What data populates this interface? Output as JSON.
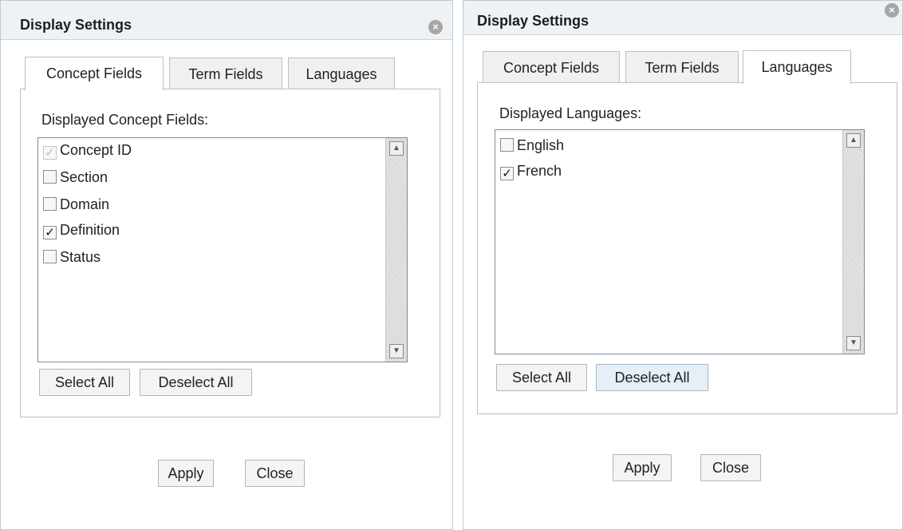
{
  "left": {
    "title": "Display Settings",
    "close_glyph": "×",
    "tabs": [
      "Concept Fields",
      "Term Fields",
      "Languages"
    ],
    "active_tab": "Concept Fields",
    "panel_label": "Displayed Concept Fields:",
    "items": [
      {
        "label": "Concept ID",
        "mark": "✓",
        "checked": true,
        "disabled": true
      },
      {
        "label": "Section",
        "mark": "",
        "checked": false
      },
      {
        "label": "Domain",
        "mark": "",
        "checked": false
      },
      {
        "label": "Definition",
        "mark": "✓",
        "checked": true
      },
      {
        "label": "Status",
        "mark": "",
        "checked": false
      }
    ],
    "select_all": "Select All",
    "deselect_all": "Deselect All",
    "apply": "Apply",
    "close": "Close"
  },
  "right": {
    "title": "Display Settings",
    "close_glyph": "×",
    "tabs": [
      "Concept Fields",
      "Term Fields",
      "Languages"
    ],
    "active_tab": "Languages",
    "panel_label": "Displayed Languages:",
    "items": [
      {
        "label": "English",
        "mark": "",
        "checked": false
      },
      {
        "label": "French",
        "mark": "✓",
        "checked": true
      }
    ],
    "select_all": "Select All",
    "deselect_all": "Deselect All",
    "apply": "Apply",
    "close": "Close"
  },
  "icons": {
    "close": "close-icon",
    "scroll_up": "▲",
    "scroll_down": "▼"
  }
}
